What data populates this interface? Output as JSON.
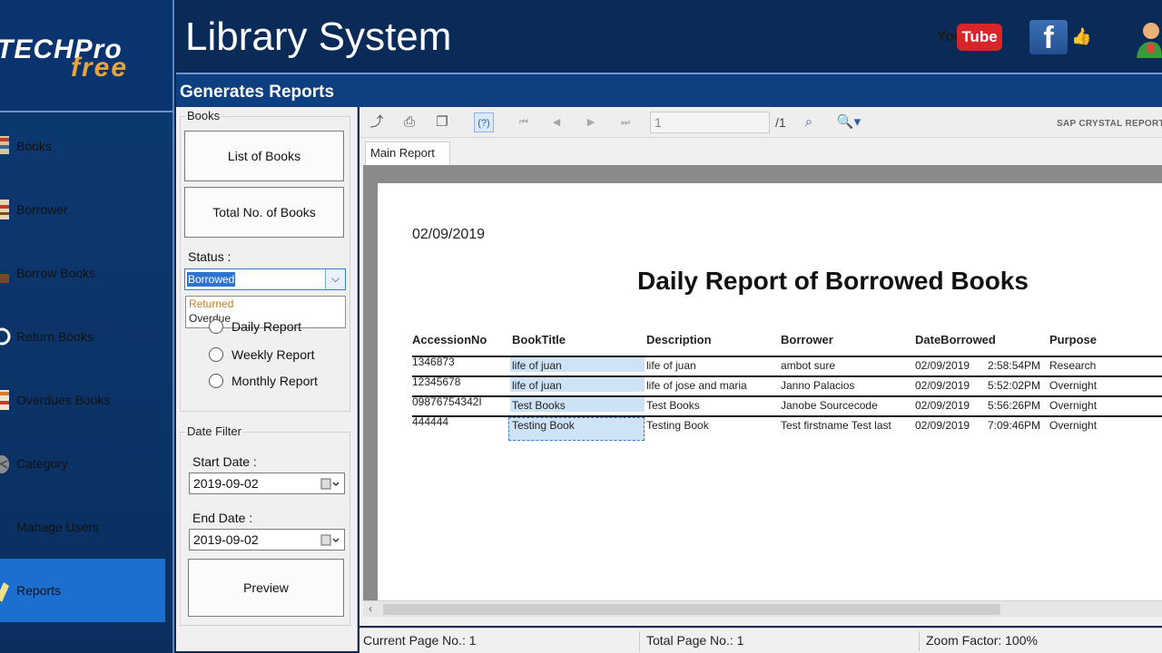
{
  "logo": {
    "line1": "TECHPro",
    "line2": "free"
  },
  "header": {
    "title": "Library System",
    "youtube_you": "You",
    "youtube_tube": "Tube",
    "facebook": "f"
  },
  "sidebar": {
    "items": [
      {
        "label": "Books",
        "icon": "book-icon"
      },
      {
        "label": "Borrower",
        "icon": "borrower-icon"
      },
      {
        "label": "Borrow Books",
        "icon": "borrow-icon"
      },
      {
        "label": "Return Books",
        "icon": "return-icon"
      },
      {
        "label": "Overdues Books",
        "icon": "overdue-icon"
      },
      {
        "label": "Category",
        "icon": "category-icon"
      },
      {
        "label": "Manage Users",
        "icon": "users-icon"
      },
      {
        "label": "Reports",
        "icon": "reports-icon",
        "active": true
      }
    ]
  },
  "subheader": {
    "title": "Generates Reports"
  },
  "panel": {
    "books_group": "Books",
    "list_of_books": "List of Books",
    "total_books": "Total No. of Books",
    "status_label": "Status :",
    "status_value": "Borrowed",
    "status_options": [
      "Returned",
      "Overdue"
    ],
    "daily_report": "Daily Report",
    "weekly_report": "Weekly Report",
    "monthly_report": "Monthly Report",
    "date_filter": "Date Filter",
    "start_label": "Start Date :",
    "start_value": "2019-09-02",
    "end_label": "End Date :",
    "end_value": "2019-09-02",
    "preview": "Preview"
  },
  "viewer": {
    "page_input": "1",
    "of_pages": "/1",
    "brand": "SAP CRYSTAL REPORTS",
    "tab": "Main Report"
  },
  "report": {
    "date": "02/09/2019",
    "title": "Daily Report of Borrowed Books",
    "headers": [
      "AccessionNo",
      "BookTitle",
      "Description",
      "Borrower",
      "DateBorrowed",
      "Purpose"
    ],
    "rows": [
      {
        "accession": "1346873",
        "title": "life of juan",
        "description": "life of juan",
        "borrower": "ambot sure",
        "date": "02/09/2019",
        "time": "2:58:54PM",
        "purpose": "Research"
      },
      {
        "accession": "12345678",
        "title": "life of juan",
        "description": "life of jose and maria",
        "borrower": "Janno Palacios",
        "date": "02/09/2019",
        "time": "5:52:02PM",
        "purpose": "Overnight"
      },
      {
        "accession": "09876754342I",
        "title": "Test Books",
        "description": "Test Books",
        "borrower": "Janobe Sourcecode",
        "date": "02/09/2019",
        "time": "5:56:26PM",
        "purpose": "Overnight"
      },
      {
        "accession": "444444",
        "title": "Testing Book",
        "description": "Testing Book",
        "borrower": "Test firstname Test last",
        "date": "02/09/2019",
        "time": "7:09:46PM",
        "purpose": "Overnight"
      }
    ]
  },
  "status": {
    "current_page": "Current Page No.: 1",
    "total_page": "Total Page No.: 1",
    "zoom": "Zoom Factor: 100%"
  }
}
